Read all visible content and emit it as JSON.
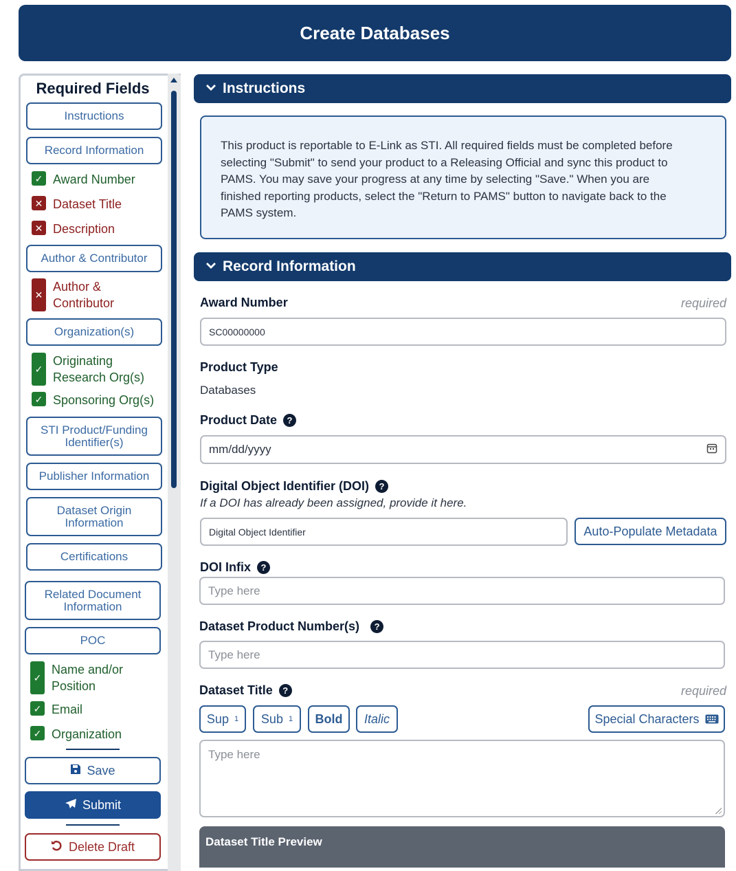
{
  "page": {
    "title": "Create Databases"
  },
  "sidebar": {
    "title": "Required Fields",
    "instructions_btn": "Instructions",
    "record_info_btn": "Record Information",
    "award_number": "Award Number",
    "dataset_title": "Dataset Title",
    "description": "Description",
    "author_contributor_btn": "Author & Contributor",
    "author_contributor_line1": "Author &",
    "author_contributor_line2": "Contributor",
    "organizations_btn": "Organization(s)",
    "orig_research_line1": "Originating",
    "orig_research_line2": "Research Org(s)",
    "sponsoring_org": "Sponsoring Org(s)",
    "sti_btn_line1": "STI Product/Funding",
    "sti_btn_line2": "Identifier(s)",
    "publisher_btn": "Publisher Information",
    "dataset_origin_line1": "Dataset Origin",
    "dataset_origin_line2": "Information",
    "certifications_btn": "Certifications",
    "related_doc_line1": "Related Document",
    "related_doc_line2": "Information",
    "poc_btn": "POC",
    "name_position_line1": "Name and/or",
    "name_position_line2": "Position",
    "email": "Email",
    "organization": "Organization",
    "save_label": "Save",
    "submit_label": "Submit",
    "delete_label": "Delete Draft"
  },
  "instructions": {
    "heading": "Instructions",
    "line1": "This product is reportable to E-Link as STI. All required fields must be completed before",
    "line2": "selecting \"Submit\" to send your product to a Releasing Official and sync this product to",
    "line3": "PAMS. You may save your progress at any time by selecting \"Save.\" When you are",
    "line4": "finished reporting products, select the \"Return to PAMS\" button to navigate back to the",
    "line5": "PAMS system."
  },
  "record": {
    "heading": "Record Information",
    "award_label": "Award Number",
    "required_text": "required",
    "award_value": "SC00000000",
    "product_type_label": "Product Type",
    "product_type_value": "Databases",
    "product_date_label": "Product Date",
    "product_date_placeholder": "mm/dd/yyyy",
    "doi_label": "Digital Object Identifier (DOI)",
    "doi_hint": "If a DOI has already been assigned, provide it here.",
    "doi_placeholder": "Digital Object Identifier",
    "auto_populate_label": "Auto-Populate Metadata",
    "doi_infix_label": "DOI Infix",
    "type_here": "Type here",
    "dataset_product_label": "Dataset Product Number(s)",
    "dataset_title_label": "Dataset Title",
    "sup_label": "Sup",
    "sub_label": "Sub",
    "script_marker": "1",
    "bold_label": "Bold",
    "italic_label": "Italic",
    "special_chars_label": "Special Characters",
    "preview_label": "Dataset Title Preview"
  },
  "colors": {
    "brand": "#133a6b",
    "ok": "#1f7a31",
    "error": "#8d1f1f"
  }
}
